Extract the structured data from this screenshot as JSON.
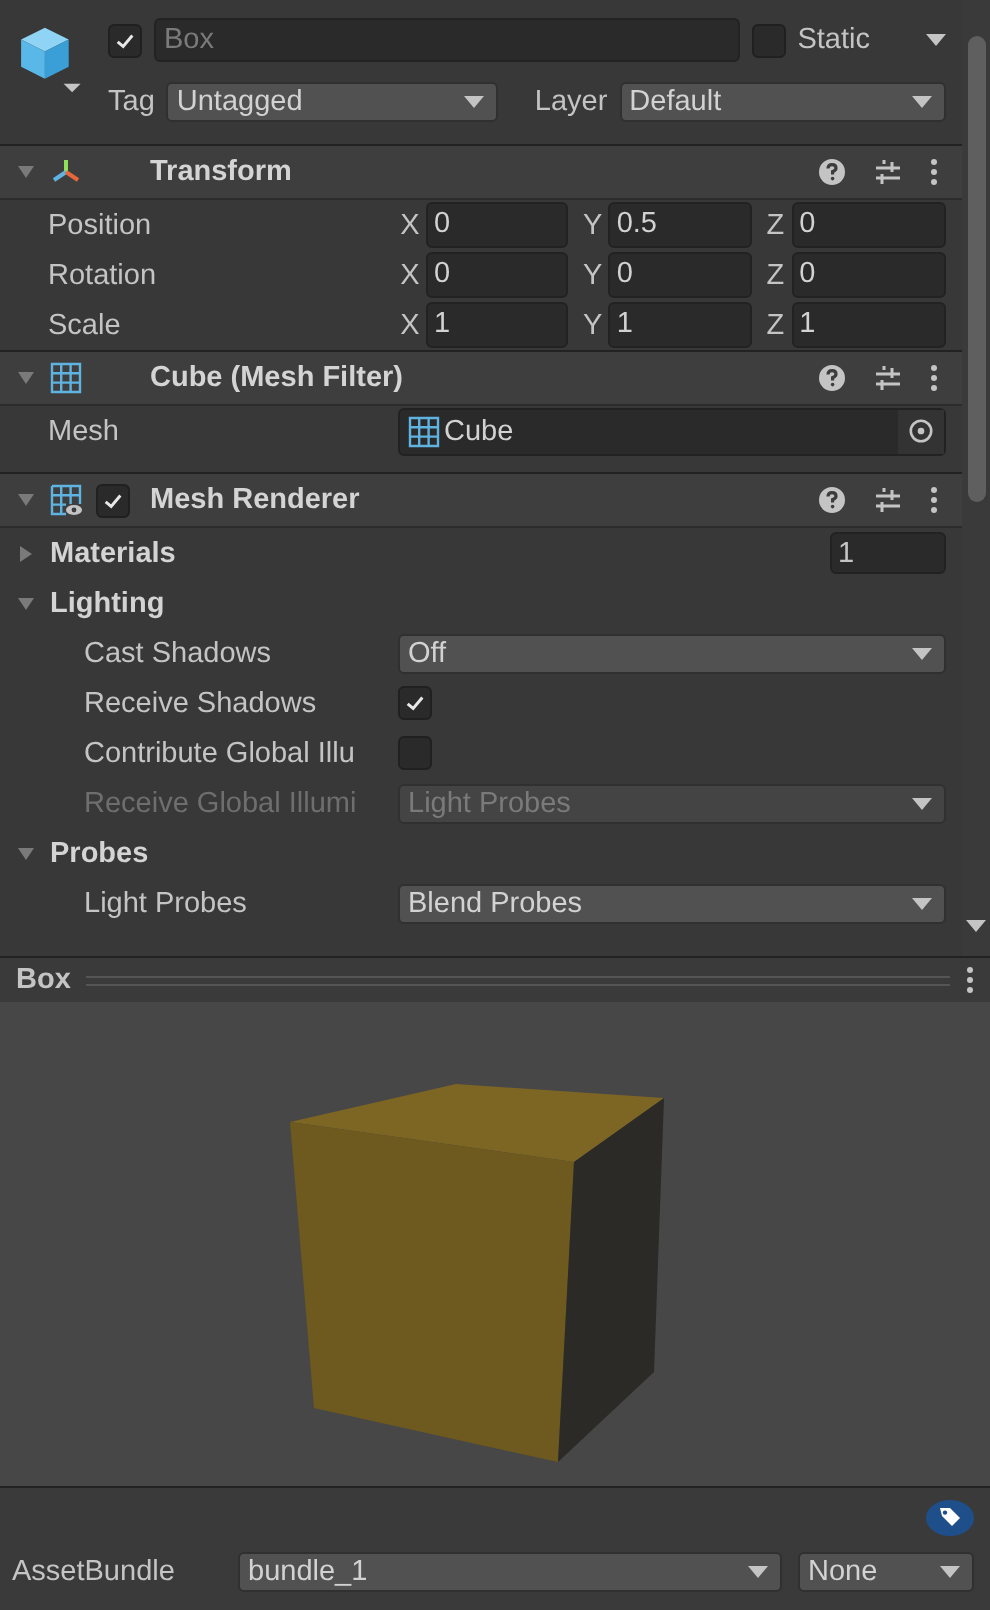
{
  "object": {
    "active": true,
    "name": "Box",
    "static": false,
    "static_label": "Static",
    "tag_label": "Tag",
    "tag": "Untagged",
    "layer_label": "Layer",
    "layer": "Default"
  },
  "components": [
    {
      "kind": "transform",
      "title": "Transform",
      "expanded": true,
      "vectors": [
        {
          "label": "Position",
          "axes": [
            {
              "axis": "X",
              "value": "0"
            },
            {
              "axis": "Y",
              "value": "0.5"
            },
            {
              "axis": "Z",
              "value": "0"
            }
          ]
        },
        {
          "label": "Rotation",
          "axes": [
            {
              "axis": "X",
              "value": "0"
            },
            {
              "axis": "Y",
              "value": "0"
            },
            {
              "axis": "Z",
              "value": "0"
            }
          ]
        },
        {
          "label": "Scale",
          "axes": [
            {
              "axis": "X",
              "value": "1"
            },
            {
              "axis": "Y",
              "value": "1"
            },
            {
              "axis": "Z",
              "value": "1"
            }
          ]
        }
      ]
    },
    {
      "kind": "mesh_filter",
      "title": "Cube (Mesh Filter)",
      "expanded": true,
      "mesh_label": "Mesh",
      "mesh": "Cube"
    },
    {
      "kind": "mesh_renderer",
      "title": "Mesh Renderer",
      "expanded": true,
      "enabled": true,
      "sections": [
        {
          "label": "Materials",
          "expanded": false,
          "count": "1"
        },
        {
          "label": "Lighting",
          "expanded": true,
          "children": [
            {
              "kind": "dropdown",
              "label": "Cast Shadows",
              "value": "Off",
              "disabled": false
            },
            {
              "kind": "checkbox",
              "label": "Receive Shadows",
              "checked": true,
              "disabled": false
            },
            {
              "kind": "checkbox",
              "label": "Contribute Global Illu",
              "checked": false,
              "disabled": false
            },
            {
              "kind": "dropdown",
              "label": "Receive Global Illumi",
              "value": "Light Probes",
              "disabled": true
            }
          ]
        },
        {
          "label": "Probes",
          "expanded": true,
          "children": [
            {
              "kind": "dropdown",
              "label": "Light Probes",
              "value": "Blend Probes",
              "disabled": false
            }
          ]
        }
      ]
    }
  ],
  "preview": {
    "title": "Box"
  },
  "asset_bundle": {
    "label": "AssetBundle",
    "bundle": "bundle_1",
    "variant": "None"
  }
}
